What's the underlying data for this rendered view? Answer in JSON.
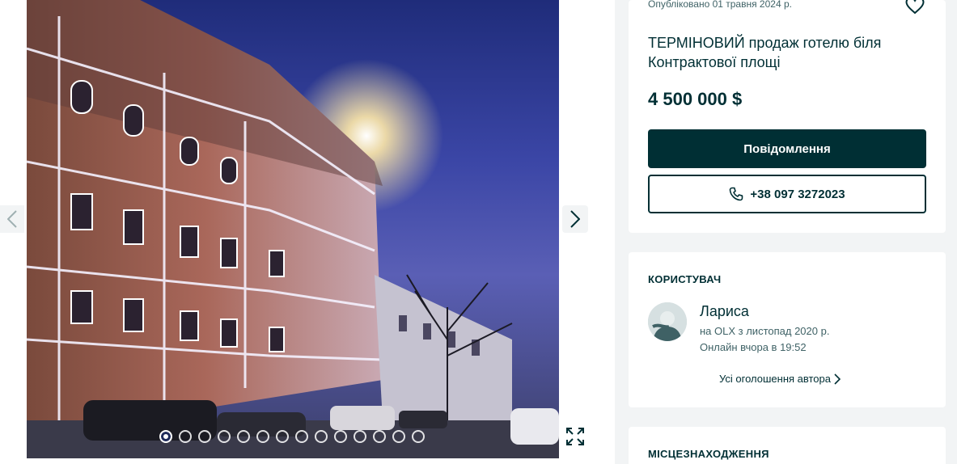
{
  "gallery": {
    "prev_icon": "chevron-left-icon",
    "next_icon": "chevron-right-icon",
    "fullscreen_icon": "expand-icon",
    "photo_count": 14,
    "active_photo": 1
  },
  "listing": {
    "published": "Опубліковано 01 травня 2024 р.",
    "favorite_icon": "heart-icon",
    "title": "ТЕРМІНОВИЙ продаж готелю біля Контрактової площі",
    "price": "4 500 000 $",
    "message_button": "Повідомлення",
    "phone_button": "+38 097 3272023",
    "phone_icon": "phone-icon"
  },
  "user": {
    "heading": "КОРИСТУВАЧ",
    "name": "Лариса",
    "since": "на OLX з листопад 2020 р.",
    "online": "Онлайн вчора в 19:52",
    "all_ads_link": "Усі оголошення автора"
  },
  "location": {
    "heading": "МІСЦЕЗНАХОДЖЕННЯ"
  },
  "colors": {
    "primary": "#002f34",
    "background": "#f2f4f5",
    "muted_text": "#406367"
  }
}
